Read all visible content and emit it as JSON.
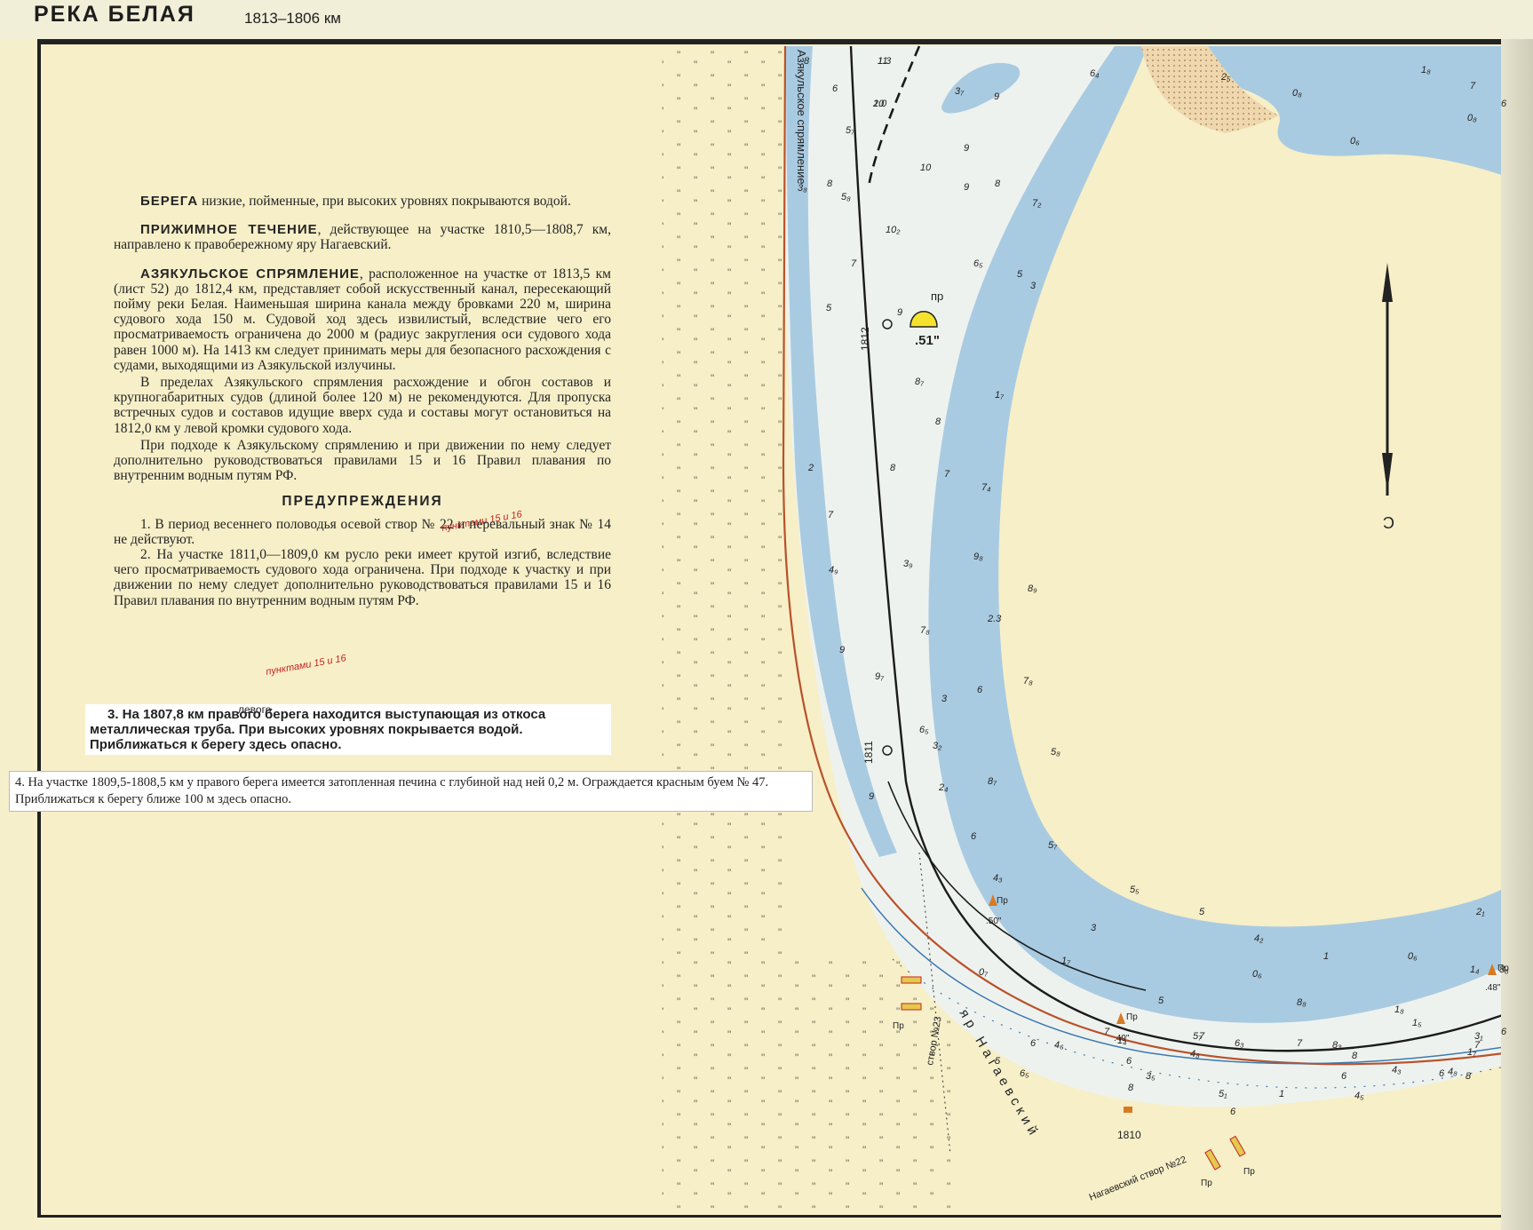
{
  "header": {
    "river_name": "РЕКА БЕЛАЯ",
    "km_range": "1813–1806 км"
  },
  "notes": {
    "berega": {
      "lead": "БЕРЕГА",
      "text": " низкие, пойменные, при высоких уровнях покрываются водой."
    },
    "prizhimnoe": {
      "lead": "ПРИЖИМНОЕ ТЕЧЕНИЕ",
      "text": ", действующее на участке 1810,5—1808,7 км, направлено к правобережному яру Нагаевский."
    },
    "azyakul": {
      "lead": "АЗЯКУЛЬСКОЕ СПРЯМЛЕНИЕ",
      "text": ", расположенное на участке от 1813,5 км (лист 52) до 1812,4 км, представляет собой искусственный канал, пересекающий пойму реки Белая. Наименьшая ширина канала между бровками 220 м, ширина судового хода 150 м. Судовой ход здесь извилистый, вследствие чего его просматриваемость ограничена до 2000 м (радиус закругления оси судового хода равен 1000 м). На 1413 км следует принимать меры для безопасного расхождения с судами, выходящими из Азякульской излучины."
    },
    "azyakul_p2": "В пределах Азякульского спрямления расхождение и обгон составов и крупногабаритных судов (длиной более 120 м) не рекомендуются. Для пропуска встречных судов и составов идущие вверх суда и составы могут остановиться на 1812,0 км у левой кромки судового хода.",
    "azyakul_p3": "При подходе к Азякульскому спрямлению и при движении по нему следует дополнительно руководствоваться правилами 15 и 16 Правил плавания по внутренним водным путям РФ.",
    "warnings_title": "ПРЕДУПРЕЖДЕНИЯ",
    "warning1": "1. В период весеннего половодья осевой створ № 22 и перевальный знак № 14 не действуют.",
    "warning2": "2. На участке 1811,0—1809,0 км русло реки имеет крутой изгиб, вследствие чего просматриваемость судового хода ограничена. При подходе к участку и при движении по нему следует дополнительно руководствоваться правилами 15 и 16 Правил плавания по внутренним водным путям РФ.",
    "warning3_lines": [
      "3. На 1807,8 км правого берега находится выступающая из откоса",
      "металлическая труба. При высоких уровнях покрывается водой.",
      "Приближаться к берегу здесь опасно."
    ],
    "warning3_correction": "левого",
    "warning4": "4. На участке 1809,5-1808,5 км у правого берега имеется затопленная печина с глубиной над ней 0,2 м. Ограждается красным буем № 47. Приближаться к берегу ближе 100 м здесь опасно.",
    "handwritten_1": "пунктами 15 и 16",
    "handwritten_2": "пунктами 15 и 16"
  },
  "map": {
    "colors": {
      "water_deep": "#a9cbe1",
      "water_shallow": "#eef2ef",
      "land": "#f6efcb",
      "sand": "#e8c9a0",
      "bank_red": "#b8522b",
      "red": "#c62323",
      "orange": "#d77a25",
      "fairway": "#1b1b1b"
    },
    "channel_name": "Азякульское спрямление",
    "bank_name": "яр Нагаевский",
    "range_22": "Нагаевский створ №22",
    "range_23": "створ №23",
    "km_posts": [
      "1812",
      "1811",
      "1810"
    ],
    "pr_labels": [
      "пр",
      "Пр",
      "Пр",
      "Пр",
      "Пр",
      "Пр",
      "Пр"
    ],
    "buoy_labels": [
      ".51\"",
      ".50\"",
      ".49\"",
      ".48\""
    ],
    "north_arrow_letter": "С",
    "depth_labels": [
      "11",
      "10",
      "8",
      "3₇",
      "9",
      "6₄",
      "2₅",
      "1₈",
      "0₈",
      "0₈",
      "0₆",
      "9",
      "10",
      "9",
      "8",
      "7₂",
      "8",
      "6₅",
      "5",
      "10₂",
      "5₈",
      "3₈",
      "6",
      "5₇",
      "7",
      "5",
      "3",
      "9",
      "8₇",
      "1₇",
      "8",
      "7",
      "7₄",
      "2",
      "7",
      "4₉",
      "8",
      "9₈",
      "8₉",
      "3₉",
      "2.3",
      "7₈",
      "9",
      "3",
      "6",
      "7₈",
      "9₇",
      "6₅",
      "5₈",
      "3₂",
      "9",
      "8₇",
      "2₄",
      "6",
      "5₇",
      "4₃",
      "5₅",
      "5",
      "3",
      "4₂",
      "1",
      "0₆",
      "2₁",
      "0₇",
      "1₄",
      "1₇",
      "0₆",
      "5",
      "8₈",
      "1₄",
      "1₅",
      "3₁",
      "4₆",
      "4₈",
      "8₃",
      "7",
      "6",
      "5₁",
      "6",
      "8",
      "6",
      "7",
      "6₅",
      "6",
      "5₇",
      "4₃",
      "4₅",
      "1",
      "6",
      "8",
      "7",
      "6",
      "7",
      "8₃",
      "7",
      "6",
      "8",
      "1₈",
      "1₇",
      "4₈",
      "6₃",
      "5",
      "3₅",
      "1.3",
      "2.0"
    ]
  }
}
